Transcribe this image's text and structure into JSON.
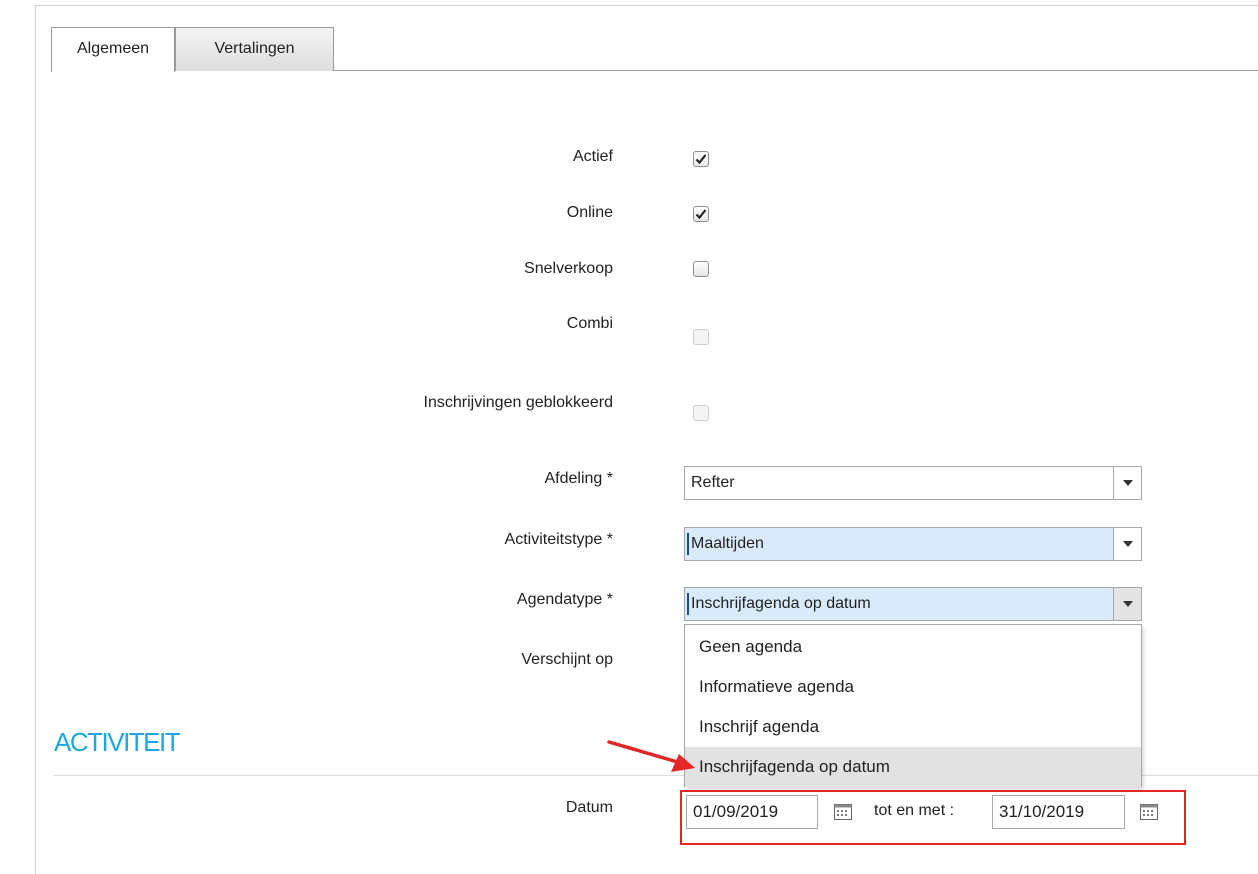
{
  "tabs": [
    {
      "label": "Algemeen",
      "active": true
    },
    {
      "label": "Vertalingen",
      "active": false
    }
  ],
  "fields": {
    "actief": {
      "label": "Actief",
      "checked": true
    },
    "online": {
      "label": "Online",
      "checked": true
    },
    "snelverkoop": {
      "label": "Snelverkoop",
      "checked": false
    },
    "combi": {
      "label": "Combi",
      "checked": false,
      "disabled": true
    },
    "geblokkeerd": {
      "label": "Inschrijvingen geblokkeerd",
      "checked": false,
      "disabled": true
    },
    "afdeling": {
      "label": "Afdeling *",
      "value": "Refter"
    },
    "activiteitstype": {
      "label": "Activiteitstype *",
      "value": "Maaltijden"
    },
    "agendatype": {
      "label": "Agendatype *",
      "value": "Inschrijfagenda op datum"
    },
    "verschijnt": {
      "label": "Verschijnt op"
    }
  },
  "agenda_options": [
    "Geen agenda",
    "Informatieve agenda",
    "Inschrijf agenda",
    "Inschrijfagenda op datum"
  ],
  "section": {
    "title": "ACTIVITEIT"
  },
  "datum": {
    "label": "Datum",
    "from": "01/09/2019",
    "between": "tot en met :",
    "to": "31/10/2019"
  },
  "colors": {
    "accent": "#1ea7e0",
    "annotation": "#e32626",
    "focus_bg": "#d9ebfb"
  },
  "icons": {
    "checkbox": "checkmark-icon",
    "select": "chevron-down-icon",
    "date": "calendar-icon",
    "annotation": "red-arrow-icon"
  }
}
